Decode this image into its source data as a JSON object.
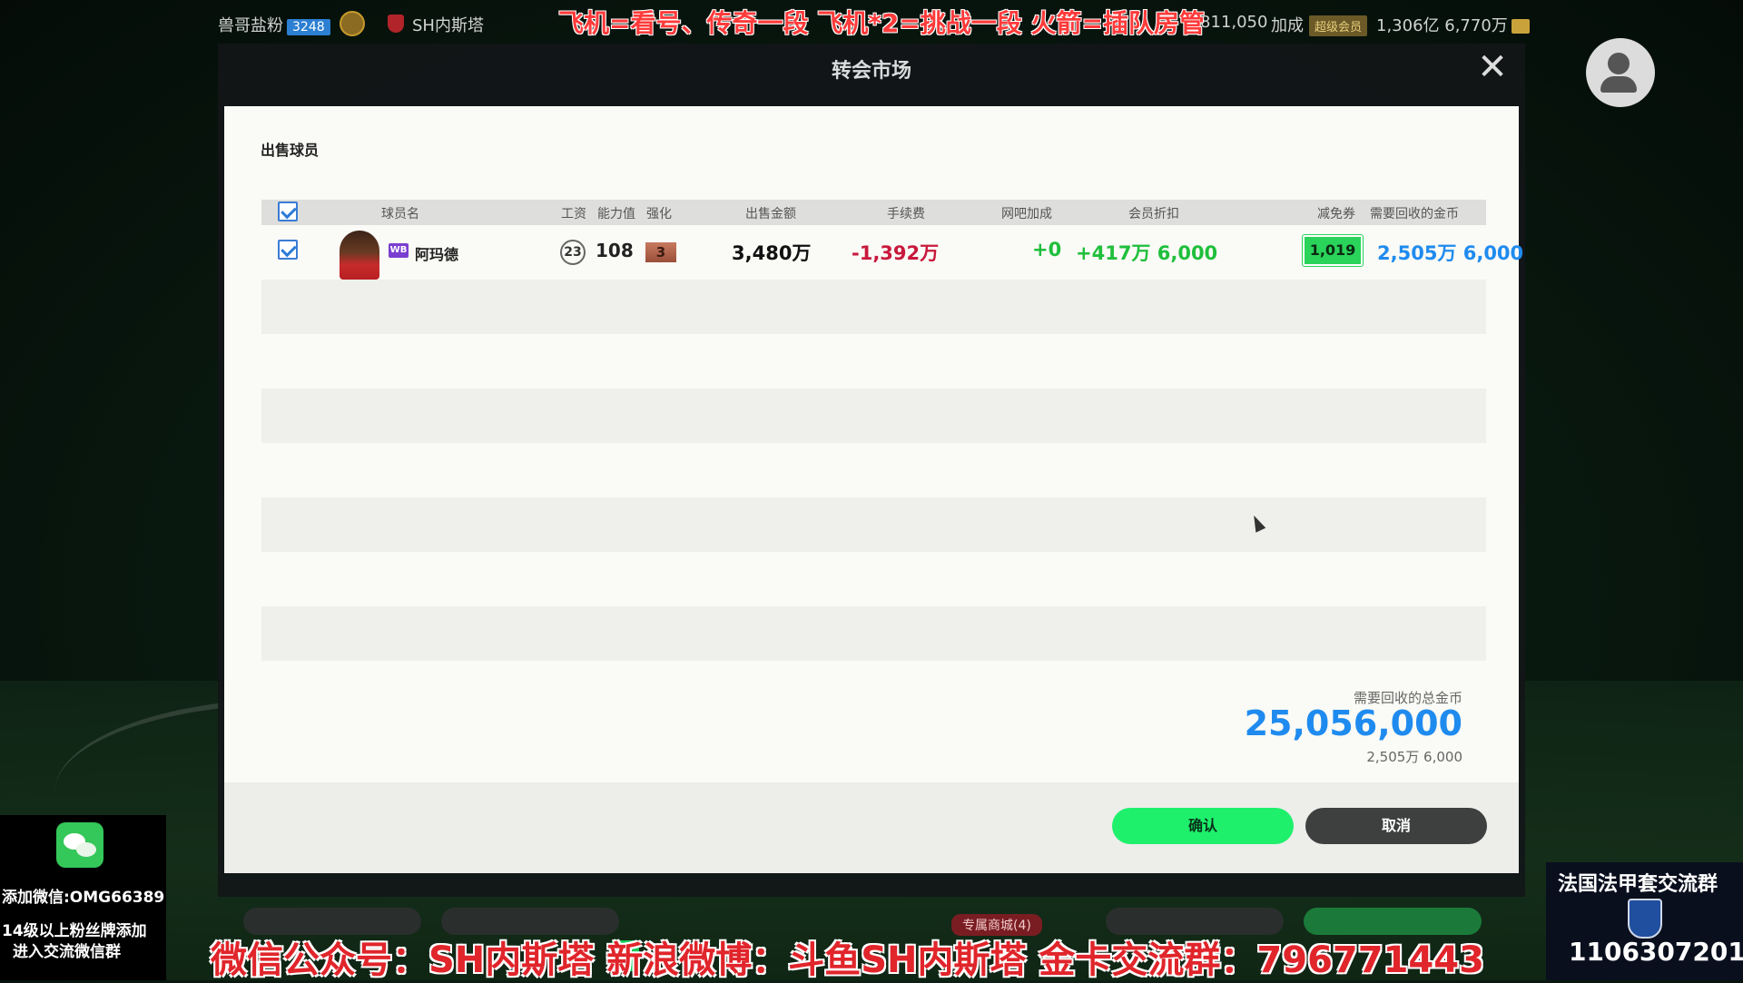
{
  "topbar": {
    "user_name": "兽哥盐粉",
    "user_level": "3248",
    "club_name": "SH内斯塔",
    "coins": "811,050",
    "bonus_label": "加成",
    "vip_label": "超级会员",
    "gold_amount": "1,306亿 6,770万",
    "stream_banner": "飞机=看号、传奇一段  飞机*2=挑战一段  火箭=插队房管"
  },
  "market": {
    "title": "转会市场"
  },
  "modal": {
    "title": "出售球员",
    "columns": {
      "name": "球员名",
      "wage": "工资",
      "ovr": "能力值",
      "enhance": "强化",
      "price": "出售金额",
      "fee": "手续费",
      "cafe_bonus": "网吧加成",
      "member_discount": "会员折扣",
      "voucher": "减免券",
      "total": "需要回收的金币"
    },
    "rows": [
      {
        "position": "WB",
        "name": "阿玛德",
        "wage": "23",
        "ovr": "108",
        "enhance": "3",
        "price": "3,480万",
        "fee": "-1,392万",
        "cafe_bonus": "+0",
        "member_discount": "+417万 6,000",
        "voucher": "1,019",
        "total": "2,505万 6,000"
      }
    ],
    "summary": {
      "label": "需要回收的总金币",
      "amount": "25,056,000",
      "amount_short": "2,505万 6,000"
    },
    "buttons": {
      "confirm": "确认",
      "cancel": "取消"
    }
  },
  "overlays": {
    "wechat_add": "添加微信:OMG66389",
    "wechat_note_1": "14级以上粉丝牌添加",
    "wechat_note_2": "进入交流微信群",
    "right_title": "法国法甲套交流群",
    "right_number": "1106307201",
    "shop_tag": "专属商城(4)",
    "bottom_banner": "微信公众号：SH内斯塔  新浪微博：斗鱼SH内斯塔  金卡交流群：796771443"
  },
  "colors": {
    "accent_blue": "#1f8bef",
    "confirm_green": "#1ff06c",
    "fee_red": "#c8193c",
    "bonus_green": "#1fbf3c",
    "voucher_green": "#2ad35a"
  }
}
